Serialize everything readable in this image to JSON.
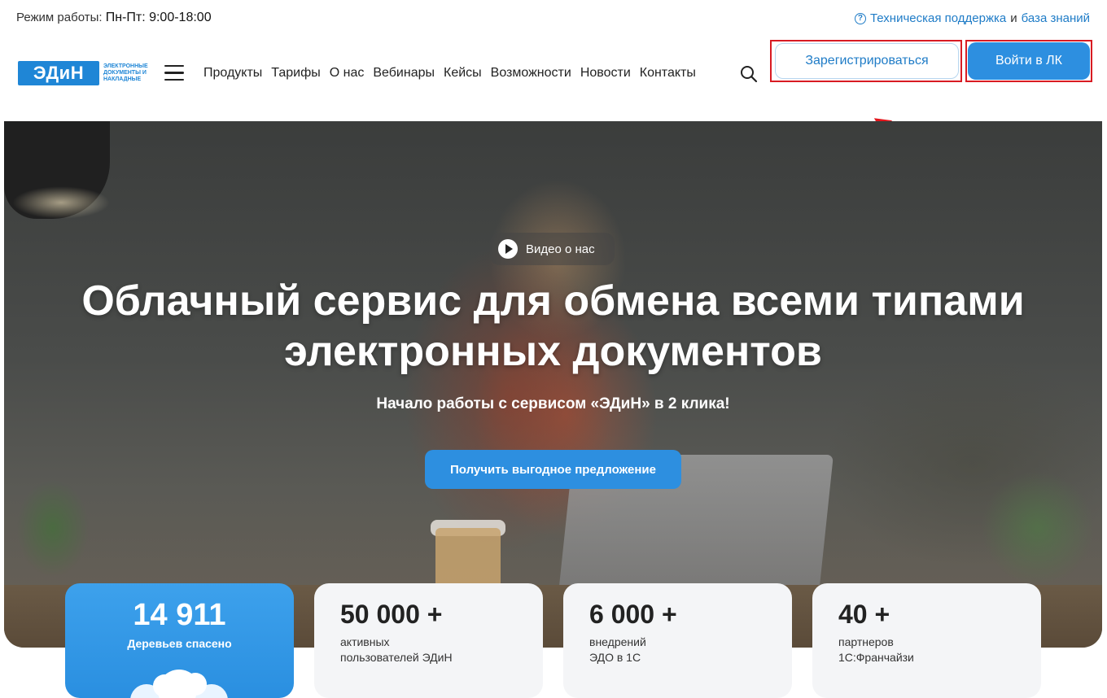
{
  "topbar": {
    "hours_label": "Режим работы:",
    "hours_value": "Пн-Пт: 9:00-18:00",
    "support_link": "Техническая поддержка",
    "conjunction": "и",
    "knowledge_link": "база знаний"
  },
  "logo": {
    "mark": "ЭДиН",
    "tagline": "электронные документы и накладные"
  },
  "nav": {
    "items": [
      "Продукты",
      "Тарифы",
      "О нас",
      "Вебинары",
      "Кейсы",
      "Возможности",
      "Новости",
      "Контакты"
    ]
  },
  "header": {
    "register_label": "Зарегистрироваться",
    "login_label": "Войти в ЛК",
    "highlight_color": "#d81b23",
    "accent_color": "#2d8fe0"
  },
  "hero": {
    "video_label": "Видео о нас",
    "title_line1": "Облачный сервис для обмена всеми типами",
    "title_line2": "электронных документов",
    "subtitle": "Начало работы с сервисом «ЭДиН» в 2 клика!",
    "cta_label": "Получить выгодное предложение"
  },
  "stats": [
    {
      "value": "14 911",
      "label1": "Деревьев спасено",
      "label2": ""
    },
    {
      "value": "50 000 +",
      "label1": "активных",
      "label2": "пользователей ЭДиН"
    },
    {
      "value": "6 000 +",
      "label1": "внедрений",
      "label2": "ЭДО в 1С"
    },
    {
      "value": "40 +",
      "label1": "партнеров",
      "label2": "1С:Франчайзи"
    }
  ]
}
